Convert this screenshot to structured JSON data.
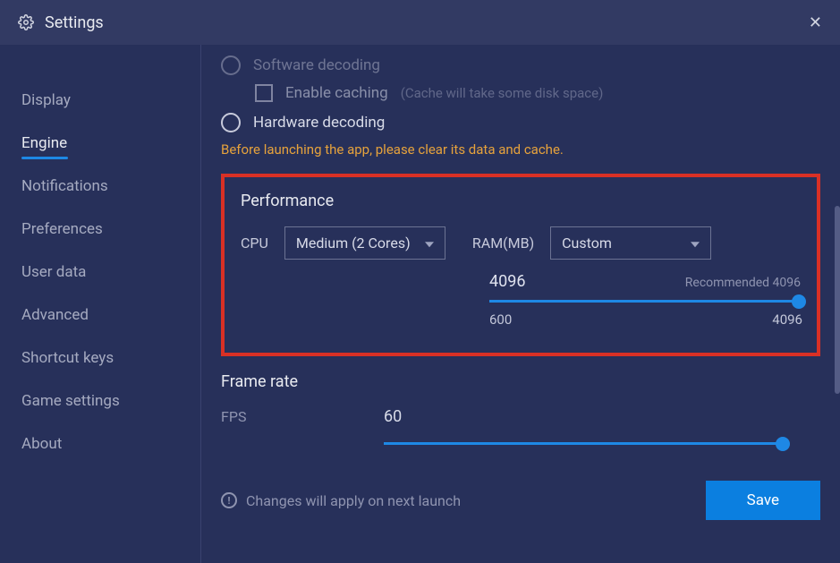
{
  "header": {
    "title": "Settings"
  },
  "sidebar": {
    "items": [
      {
        "label": "Display"
      },
      {
        "label": "Engine"
      },
      {
        "label": "Notifications"
      },
      {
        "label": "Preferences"
      },
      {
        "label": "User data"
      },
      {
        "label": "Advanced"
      },
      {
        "label": "Shortcut keys"
      },
      {
        "label": "Game settings"
      },
      {
        "label": "About"
      }
    ],
    "active_index": 1
  },
  "decoding": {
    "software_label": "Software decoding",
    "enable_caching_label": "Enable caching",
    "caching_hint": "(Cache will take some disk space)",
    "hardware_label": "Hardware decoding",
    "warning": "Before launching the app, please clear its data and cache."
  },
  "performance": {
    "title": "Performance",
    "cpu_label": "CPU",
    "cpu_selected": "Medium (2 Cores)",
    "ram_label": "RAM(MB)",
    "ram_selected": "Custom",
    "ram_value": "4096",
    "ram_recommended": "Recommended 4096",
    "ram_min": "600",
    "ram_max": "4096"
  },
  "framerate": {
    "title": "Frame rate",
    "fps_label": "FPS",
    "fps_value": "60"
  },
  "footer": {
    "note": "Changes will apply on next launch",
    "save_label": "Save"
  }
}
